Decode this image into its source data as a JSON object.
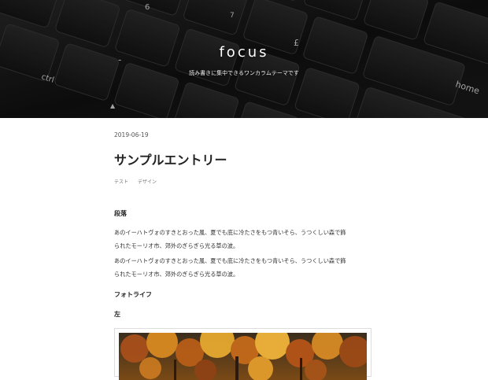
{
  "header": {
    "site_title": "focus",
    "tagline": "読み書きに集中できるワンカラムテーマです"
  },
  "keyboard_keys": {
    "ctrl": "ctrl",
    "home": "home",
    "six": "6",
    "pound": "£",
    "dollar": "$",
    "seven": "7",
    "minus": "-",
    "arrow": "▲"
  },
  "post": {
    "date": "2019-06-19",
    "title": "サンプルエントリー",
    "tags": [
      "テスト",
      "デザイン"
    ],
    "sections": {
      "paragraph_heading": "段落",
      "paragraph_1_line_1": "あのイーハトヴォのすきとおった風、夏でも底に冷たさをもつ青いそら、うつくしい森で飾",
      "paragraph_1_line_2": "られたモーリオ市、郊外のぎらぎら光る草の波。",
      "paragraph_2_line_1": "あのイーハトヴォのすきとおった風、夏でも底に冷たさをもつ青いそら、うつくしい森で飾",
      "paragraph_2_line_2": "られたモーリオ市、郊外のぎらぎら光る草の波。",
      "photolife_heading": "フォトライフ",
      "left_heading": "左"
    }
  },
  "colors": {
    "header_bg": "#141414",
    "key_face": "#1d1d1d",
    "title_text": "#222222",
    "body_text": "#333333"
  }
}
